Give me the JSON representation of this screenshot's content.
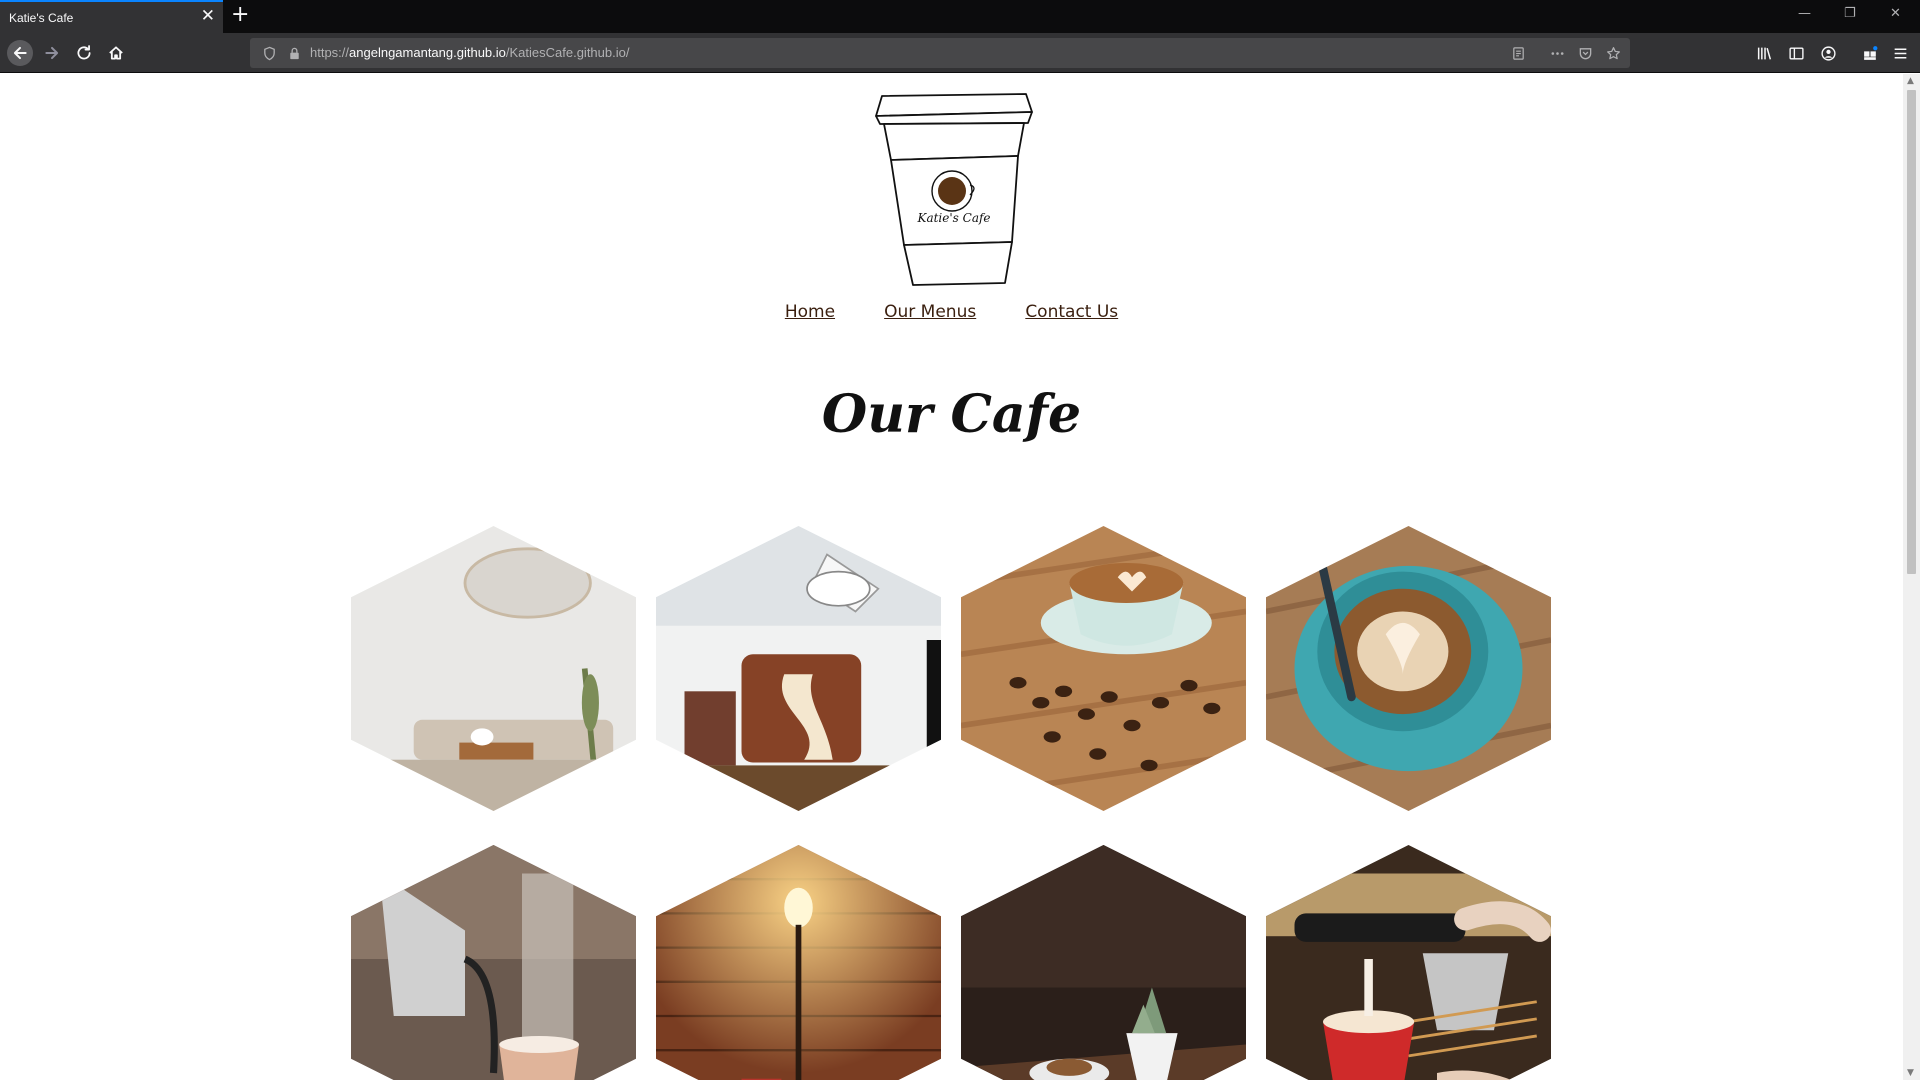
{
  "browser": {
    "tab_title": "Katie's Cafe",
    "tab_close": "✕",
    "new_tab": "+",
    "url_scheme": "https://",
    "url_host": "angelngamantang.github.io",
    "url_path": "/KatiesCafe.github.io/"
  },
  "logo": {
    "text": "Katie's Cafe"
  },
  "nav": {
    "items": [
      "Home",
      "Our Menus",
      "Contact Us"
    ]
  },
  "main": {
    "title": "Our Cafe"
  },
  "gallery": {
    "images": [
      "cafe-interior-image",
      "pour-over-coffee-image",
      "latte-beans-image",
      "latte-art-image",
      "kettle-pour-image",
      "brick-wall-lamp-image",
      "coffee-succulent-image",
      "espresso-machine-image"
    ]
  },
  "colors": {
    "link": "#3a1f0f",
    "accent": "#0a84ff"
  }
}
